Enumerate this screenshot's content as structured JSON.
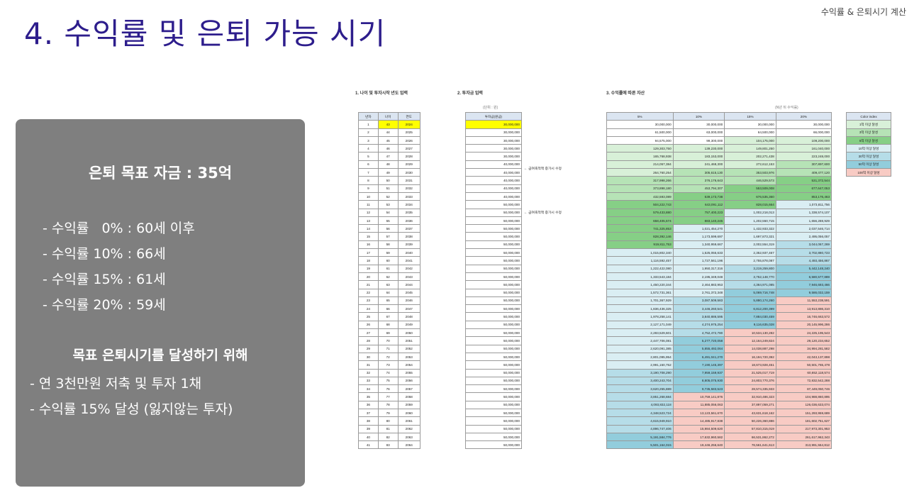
{
  "header": {
    "top_label": "수익률 & 은퇴시기 계산",
    "title": "4. 수익률 및 은퇴 가능 시기"
  },
  "panel": {
    "heading": "은퇴 목표 자금 : 35억",
    "rates": [
      "- 수익률   0% : 60세 이후",
      "- 수익률 10% : 66세",
      "- 수익률 15% : 61세",
      "- 수익률 20% : 59세"
    ],
    "subheading": "목표 은퇴시기를 달성하기 위해",
    "goals": [
      "- 연 3천만원 저축 및 투자 1채",
      "- 수익률 15% 달성 (잃지않는 투자)"
    ]
  },
  "sheet": {
    "section1_title": "1. 나이 및 투자시작 년도 입력",
    "section2_title": "2. 투자금 입력",
    "section3_title": "3. 수익률에 따른 자산",
    "unit_note_left": "(단위 : 원)",
    "unit_note_right": "(N년 뒤 수익률)",
    "t1_headers": [
      "년차",
      "나이",
      "연도"
    ],
    "t2_header": "투자금(원금)",
    "t3_headers": [
      "5%",
      "10%",
      "15%",
      "20%"
    ],
    "note_40m": "← 급여축적액 증가시 수정",
    "note_50m": "← 급여축적액 증가시 수정",
    "legend_header": "Color index",
    "legend": [
      {
        "label": "1억 이상 달성",
        "color": "#d8f0d8"
      },
      {
        "label": "3억 이상 달성",
        "color": "#b6e3b6"
      },
      {
        "label": "5억 이상 달성",
        "color": "#86cf86"
      },
      {
        "label": "10억 이상 달성",
        "color": "#daeef3"
      },
      {
        "label": "30억 이상 달성",
        "color": "#b6dde8"
      },
      {
        "label": "50억 이상 달성",
        "color": "#92cddc"
      },
      {
        "label": "100억 이상 달성",
        "color": "#f8cbc4"
      }
    ],
    "color_thresholds": [
      {
        "min": 10000000000,
        "color": "#f8cbc4"
      },
      {
        "min": 5000000000,
        "color": "#92cddc"
      },
      {
        "min": 3000000000,
        "color": "#b6dde8"
      },
      {
        "min": 1000000000,
        "color": "#daeef3"
      },
      {
        "min": 500000000,
        "color": "#86cf86"
      },
      {
        "min": 300000000,
        "color": "#b6e3b6"
      },
      {
        "min": 100000000,
        "color": "#d8f0d8"
      }
    ],
    "rows": [
      [
        "1",
        "43",
        "2024",
        "30,000,000",
        "30,000,000",
        "30,000,000",
        "30,000,000",
        "30,000,000"
      ],
      [
        "2",
        "44",
        "2025",
        "30,000,000",
        "61,500,000",
        "63,000,000",
        "64,500,000",
        "66,000,000"
      ],
      [
        "3",
        "45",
        "2026",
        "30,000,000",
        "94,575,000",
        "99,300,000",
        "104,175,000",
        "109,200,000"
      ],
      [
        "4",
        "46",
        "2027",
        "30,000,000",
        "129,303,750",
        "139,230,000",
        "149,801,250",
        "161,040,000"
      ],
      [
        "5",
        "47",
        "2028",
        "30,000,000",
        "165,768,938",
        "183,153,000",
        "202,271,438",
        "223,248,000"
      ],
      [
        "6",
        "48",
        "2029",
        "40,000,000",
        "214,057,384",
        "241,468,300",
        "272,612,153",
        "307,897,600"
      ],
      [
        "7",
        "49",
        "2030",
        "40,000,000",
        "264,760,254",
        "305,615,130",
        "353,503,976",
        "409,477,120"
      ],
      [
        "8",
        "50",
        "2031",
        "40,000,000",
        "317,998,266",
        "376,176,643",
        "446,529,573",
        "531,372,544"
      ],
      [
        "9",
        "51",
        "2032",
        "40,000,000",
        "373,898,180",
        "453,794,307",
        "553,509,008",
        "677,647,053"
      ],
      [
        "10",
        "52",
        "2033",
        "40,000,000",
        "432,593,089",
        "539,173,738",
        "676,535,360",
        "853,176,463"
      ],
      [
        "11",
        "53",
        "2034",
        "50,000,000",
        "504,222,743",
        "643,091,112",
        "828,015,664",
        "1,073,811,756"
      ],
      [
        "12",
        "54",
        "2035",
        "50,000,000",
        "579,433,880",
        "757,400,223",
        "1,002,218,013",
        "1,338,574,107"
      ],
      [
        "13",
        "55",
        "2036",
        "50,000,000",
        "658,405,574",
        "883,140,245",
        "1,202,550,715",
        "1,656,288,929"
      ],
      [
        "14",
        "56",
        "2037",
        "50,000,000",
        "741,325,853",
        "1,021,454,270",
        "1,432,933,322",
        "2,037,546,714"
      ],
      [
        "15",
        "57",
        "2038",
        "50,000,000",
        "828,392,146",
        "1,173,599,697",
        "1,697,873,321",
        "2,495,056,057"
      ],
      [
        "16",
        "58",
        "2039",
        "50,000,000",
        "919,811,753",
        "1,340,959,667",
        "2,002,554,319",
        "3,044,067,269"
      ],
      [
        "17",
        "59",
        "2040",
        "50,000,000",
        "1,015,802,340",
        "1,525,055,633",
        "2,352,937,467",
        "3,702,880,723"
      ],
      [
        "18",
        "60",
        "2041",
        "50,000,000",
        "1,116,592,457",
        "1,727,561,196",
        "2,755,878,087",
        "4,493,456,867"
      ],
      [
        "19",
        "61",
        "2042",
        "50,000,000",
        "1,222,422,080",
        "1,950,317,316",
        "3,219,259,800",
        "5,442,148,240"
      ],
      [
        "20",
        "62",
        "2043",
        "50,000,000",
        "1,333,543,184",
        "2,195,349,048",
        "3,752,148,770",
        "6,580,577,889"
      ],
      [
        "21",
        "63",
        "2044",
        "50,000,000",
        "1,450,220,344",
        "2,464,883,953",
        "4,364,971,085",
        "7,946,693,466"
      ],
      [
        "22",
        "64",
        "2045",
        "50,000,000",
        "1,572,731,361",
        "2,761,372,348",
        "5,069,716,748",
        "9,586,032,159"
      ],
      [
        "23",
        "65",
        "2046",
        "50,000,000",
        "1,701,367,929",
        "3,087,509,583",
        "5,880,174,260",
        "11,553,238,591"
      ],
      [
        "24",
        "66",
        "2047",
        "50,000,000",
        "1,836,436,325",
        "3,446,260,541",
        "6,812,200,399",
        "13,913,886,310"
      ],
      [
        "25",
        "67",
        "2048",
        "50,000,000",
        "1,978,258,141",
        "3,840,886,595",
        "7,884,030,459",
        "16,746,663,572"
      ],
      [
        "26",
        "68",
        "2049",
        "50,000,000",
        "2,127,171,049",
        "4,274,975,254",
        "9,116,635,028",
        "20,145,996,286"
      ],
      [
        "27",
        "69",
        "2050",
        "50,000,000",
        "2,283,529,601",
        "4,752,472,780",
        "10,534,130,282",
        "24,225,195,543"
      ],
      [
        "28",
        "70",
        "2051",
        "50,000,000",
        "2,447,706,081",
        "5,277,720,058",
        "12,164,249,824",
        "29,120,234,652"
      ],
      [
        "29",
        "71",
        "2052",
        "50,000,000",
        "2,620,091,385",
        "5,855,492,064",
        "14,038,887,298",
        "34,994,281,582"
      ],
      [
        "30",
        "72",
        "2053",
        "50,000,000",
        "2,801,095,954",
        "6,491,041,270",
        "16,194,720,392",
        "42,043,137,898"
      ],
      [
        "31",
        "73",
        "2054",
        "50,000,000",
        "2,991,150,752",
        "7,190,145,397",
        "18,673,928,451",
        "50,501,765,478"
      ],
      [
        "32",
        "74",
        "2055",
        "50,000,000",
        "3,190,708,290",
        "7,959,159,937",
        "21,525,017,719",
        "60,652,118,574"
      ],
      [
        "33",
        "75",
        "2056",
        "50,000,000",
        "3,400,243,704",
        "8,805,075,930",
        "24,803,770,376",
        "72,832,542,288"
      ],
      [
        "34",
        "76",
        "2057",
        "50,000,000",
        "3,620,255,889",
        "9,735,583,523",
        "28,574,335,933",
        "87,449,050,746"
      ],
      [
        "35",
        "77",
        "2058",
        "50,000,000",
        "3,851,268,684",
        "10,759,141,876",
        "32,910,486,323",
        "104,988,860,895"
      ],
      [
        "36",
        "78",
        "2059",
        "50,000,000",
        "4,093,832,118",
        "11,885,056,063",
        "37,897,059,271",
        "126,036,633,074"
      ],
      [
        "37",
        "79",
        "2060",
        "50,000,000",
        "4,348,523,724",
        "13,123,561,670",
        "43,631,618,162",
        "151,293,959,689"
      ],
      [
        "38",
        "80",
        "2061",
        "50,000,000",
        "4,615,949,910",
        "14,485,917,838",
        "50,226,360,886",
        "181,602,751,627"
      ],
      [
        "39",
        "81",
        "2062",
        "50,000,000",
        "4,896,747,406",
        "15,984,509,620",
        "57,810,315,019",
        "217,973,301,953"
      ],
      [
        "40",
        "82",
        "2063",
        "50,000,000",
        "5,191,584,776",
        "17,632,960,582",
        "66,531,862,272",
        "261,617,962,343"
      ],
      [
        "41",
        "83",
        "2064",
        "50,000,000",
        "5,501,164,015",
        "19,446,256,640",
        "76,561,641,613",
        "313,991,554,812"
      ]
    ]
  }
}
